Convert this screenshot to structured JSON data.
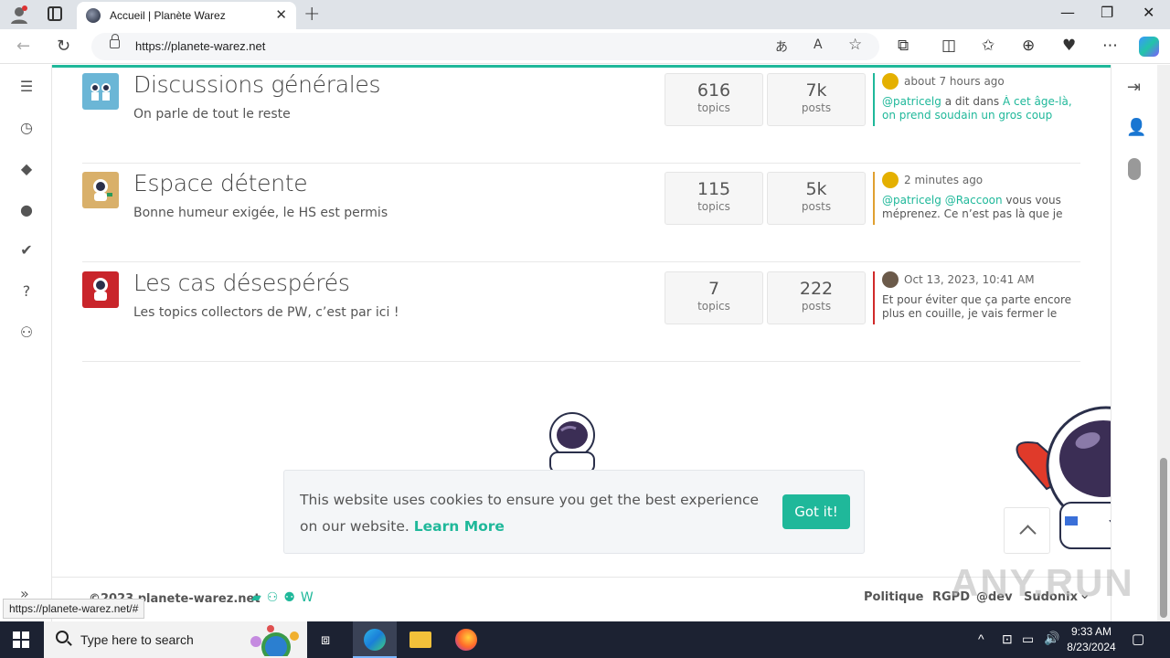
{
  "browser": {
    "tab_title": "Accueil | Planète Warez",
    "url": "https://planete-warez.net",
    "status_url": "https://planete-warez.net/#"
  },
  "categories": [
    {
      "title": "Discussions générales",
      "desc": "On parle de tout le reste",
      "topics": "616",
      "topics_label": "topics",
      "posts": "7k",
      "posts_label": "posts",
      "last_time": "about 7 hours ago",
      "last_user": "@patricelg",
      "last_mid": " a dit dans ",
      "last_link": "À cet âge-là, on prend soudain un gros coup de…",
      "accent": "#1fb89a",
      "icon_bg": "#6bb6d6"
    },
    {
      "title": "Espace détente",
      "desc": "Bonne humeur exigée, le HS est permis",
      "topics": "115",
      "topics_label": "topics",
      "posts": "5k",
      "posts_label": "posts",
      "last_time": "2 minutes ago",
      "last_user": "@patricelg @Raccoon",
      "last_rest": " vous vous méprenez. Ce n’est pas là que je m…",
      "accent": "#e0a030",
      "icon_bg": "#d9b06a"
    },
    {
      "title": "Les cas désespérés",
      "desc": "Les topics collectors de PW, c’est par ici !",
      "topics": "7",
      "topics_label": "topics",
      "posts": "222",
      "posts_label": "posts",
      "last_time": "Oct 13, 2023, 10:41 AM",
      "last_rest": "Et pour éviter que ça parte encore plus en couille, je vais fermer le suje…",
      "accent": "#d02a2a",
      "icon_bg": "#c9252b"
    }
  ],
  "cookie": {
    "message": "This website uses cookies to ensure you get the best experience on our website.",
    "link": "Learn More",
    "button": "Got it!"
  },
  "footer": {
    "copyright": "©2023 planete-warez.net",
    "links": [
      "Politique",
      "RGPD",
      "@dev",
      "Sudonix"
    ]
  },
  "watermark": "ANY.RUN",
  "taskbar": {
    "search_placeholder": "Type here to search",
    "time": "9:33 AM",
    "date": "8/23/2024"
  },
  "colors": {
    "accent": "#1fb89a",
    "taskbar": "#1c2232"
  }
}
